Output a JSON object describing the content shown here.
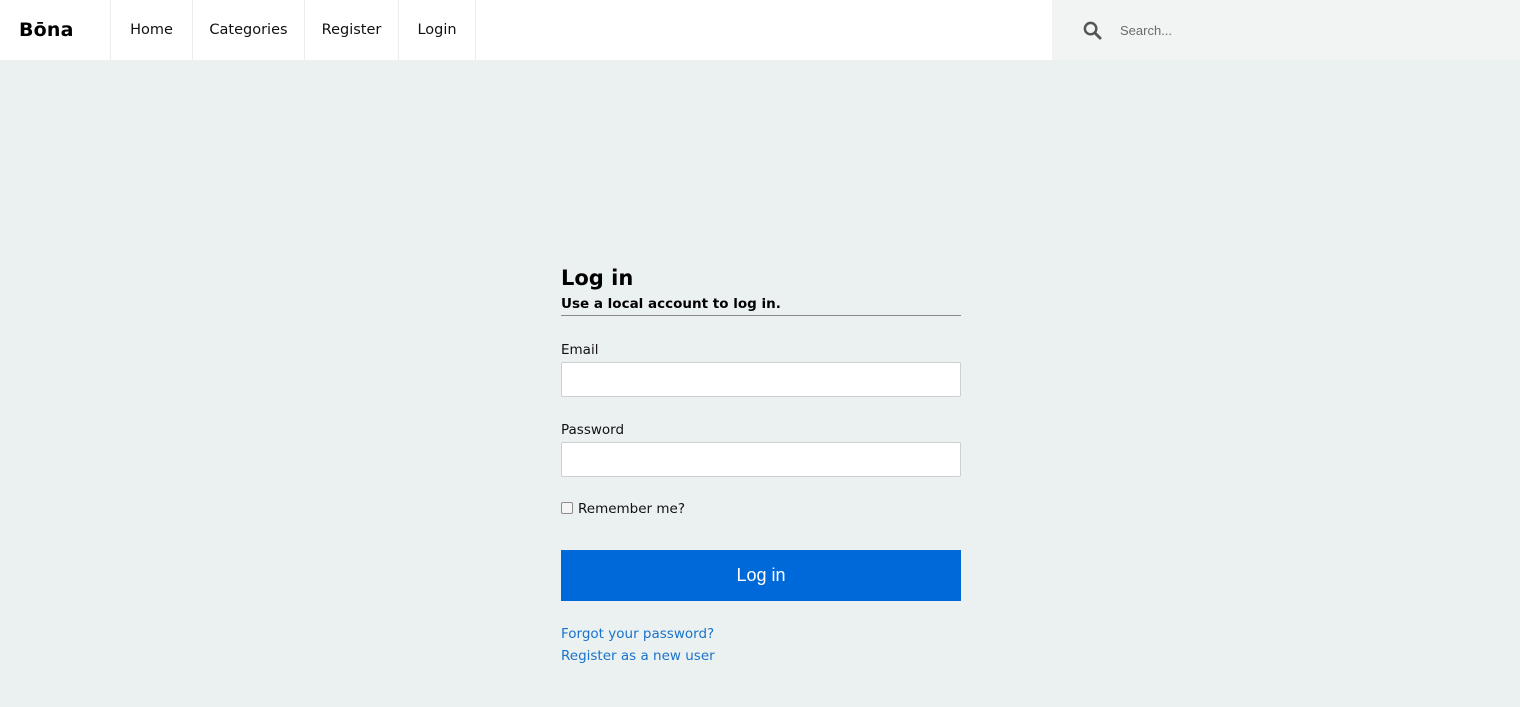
{
  "header": {
    "brand": "Bōna",
    "nav": [
      "Home",
      "Categories",
      "Register",
      "Login"
    ],
    "search": {
      "placeholder": "Search..."
    }
  },
  "login": {
    "title": "Log in",
    "subtitle": "Use a local account to log in.",
    "email_label": "Email",
    "email_value": "",
    "password_label": "Password",
    "password_value": "",
    "remember_label": "Remember me?",
    "remember_checked": false,
    "submit_label": "Log in",
    "forgot_link": "Forgot your password?",
    "register_link": "Register as a new user"
  },
  "colors": {
    "page_background": "#ebf1f1",
    "primary_button": "#0069d9",
    "link": "#1a73c9"
  },
  "icons": {
    "search": "search-icon"
  }
}
